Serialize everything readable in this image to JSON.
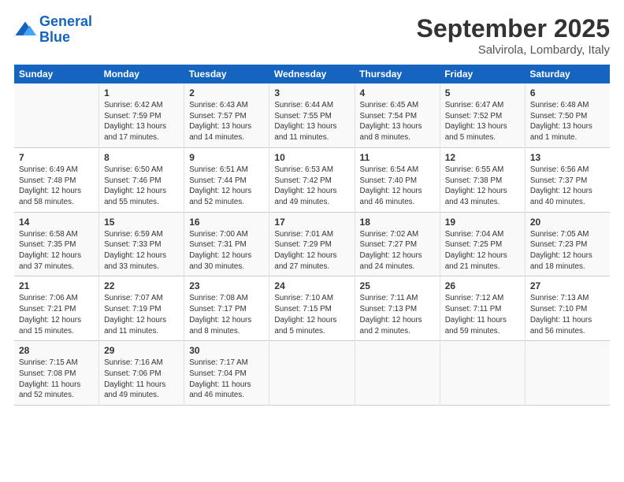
{
  "logo": {
    "line1": "General",
    "line2": "Blue"
  },
  "title": "September 2025",
  "location": "Salvirola, Lombardy, Italy",
  "days_header": [
    "Sunday",
    "Monday",
    "Tuesday",
    "Wednesday",
    "Thursday",
    "Friday",
    "Saturday"
  ],
  "weeks": [
    [
      {
        "num": "",
        "info": ""
      },
      {
        "num": "1",
        "info": "Sunrise: 6:42 AM\nSunset: 7:59 PM\nDaylight: 13 hours\nand 17 minutes."
      },
      {
        "num": "2",
        "info": "Sunrise: 6:43 AM\nSunset: 7:57 PM\nDaylight: 13 hours\nand 14 minutes."
      },
      {
        "num": "3",
        "info": "Sunrise: 6:44 AM\nSunset: 7:55 PM\nDaylight: 13 hours\nand 11 minutes."
      },
      {
        "num": "4",
        "info": "Sunrise: 6:45 AM\nSunset: 7:54 PM\nDaylight: 13 hours\nand 8 minutes."
      },
      {
        "num": "5",
        "info": "Sunrise: 6:47 AM\nSunset: 7:52 PM\nDaylight: 13 hours\nand 5 minutes."
      },
      {
        "num": "6",
        "info": "Sunrise: 6:48 AM\nSunset: 7:50 PM\nDaylight: 13 hours\nand 1 minute."
      }
    ],
    [
      {
        "num": "7",
        "info": "Sunrise: 6:49 AM\nSunset: 7:48 PM\nDaylight: 12 hours\nand 58 minutes."
      },
      {
        "num": "8",
        "info": "Sunrise: 6:50 AM\nSunset: 7:46 PM\nDaylight: 12 hours\nand 55 minutes."
      },
      {
        "num": "9",
        "info": "Sunrise: 6:51 AM\nSunset: 7:44 PM\nDaylight: 12 hours\nand 52 minutes."
      },
      {
        "num": "10",
        "info": "Sunrise: 6:53 AM\nSunset: 7:42 PM\nDaylight: 12 hours\nand 49 minutes."
      },
      {
        "num": "11",
        "info": "Sunrise: 6:54 AM\nSunset: 7:40 PM\nDaylight: 12 hours\nand 46 minutes."
      },
      {
        "num": "12",
        "info": "Sunrise: 6:55 AM\nSunset: 7:38 PM\nDaylight: 12 hours\nand 43 minutes."
      },
      {
        "num": "13",
        "info": "Sunrise: 6:56 AM\nSunset: 7:37 PM\nDaylight: 12 hours\nand 40 minutes."
      }
    ],
    [
      {
        "num": "14",
        "info": "Sunrise: 6:58 AM\nSunset: 7:35 PM\nDaylight: 12 hours\nand 37 minutes."
      },
      {
        "num": "15",
        "info": "Sunrise: 6:59 AM\nSunset: 7:33 PM\nDaylight: 12 hours\nand 33 minutes."
      },
      {
        "num": "16",
        "info": "Sunrise: 7:00 AM\nSunset: 7:31 PM\nDaylight: 12 hours\nand 30 minutes."
      },
      {
        "num": "17",
        "info": "Sunrise: 7:01 AM\nSunset: 7:29 PM\nDaylight: 12 hours\nand 27 minutes."
      },
      {
        "num": "18",
        "info": "Sunrise: 7:02 AM\nSunset: 7:27 PM\nDaylight: 12 hours\nand 24 minutes."
      },
      {
        "num": "19",
        "info": "Sunrise: 7:04 AM\nSunset: 7:25 PM\nDaylight: 12 hours\nand 21 minutes."
      },
      {
        "num": "20",
        "info": "Sunrise: 7:05 AM\nSunset: 7:23 PM\nDaylight: 12 hours\nand 18 minutes."
      }
    ],
    [
      {
        "num": "21",
        "info": "Sunrise: 7:06 AM\nSunset: 7:21 PM\nDaylight: 12 hours\nand 15 minutes."
      },
      {
        "num": "22",
        "info": "Sunrise: 7:07 AM\nSunset: 7:19 PM\nDaylight: 12 hours\nand 11 minutes."
      },
      {
        "num": "23",
        "info": "Sunrise: 7:08 AM\nSunset: 7:17 PM\nDaylight: 12 hours\nand 8 minutes."
      },
      {
        "num": "24",
        "info": "Sunrise: 7:10 AM\nSunset: 7:15 PM\nDaylight: 12 hours\nand 5 minutes."
      },
      {
        "num": "25",
        "info": "Sunrise: 7:11 AM\nSunset: 7:13 PM\nDaylight: 12 hours\nand 2 minutes."
      },
      {
        "num": "26",
        "info": "Sunrise: 7:12 AM\nSunset: 7:11 PM\nDaylight: 11 hours\nand 59 minutes."
      },
      {
        "num": "27",
        "info": "Sunrise: 7:13 AM\nSunset: 7:10 PM\nDaylight: 11 hours\nand 56 minutes."
      }
    ],
    [
      {
        "num": "28",
        "info": "Sunrise: 7:15 AM\nSunset: 7:08 PM\nDaylight: 11 hours\nand 52 minutes."
      },
      {
        "num": "29",
        "info": "Sunrise: 7:16 AM\nSunset: 7:06 PM\nDaylight: 11 hours\nand 49 minutes."
      },
      {
        "num": "30",
        "info": "Sunrise: 7:17 AM\nSunset: 7:04 PM\nDaylight: 11 hours\nand 46 minutes."
      },
      {
        "num": "",
        "info": ""
      },
      {
        "num": "",
        "info": ""
      },
      {
        "num": "",
        "info": ""
      },
      {
        "num": "",
        "info": ""
      }
    ]
  ]
}
